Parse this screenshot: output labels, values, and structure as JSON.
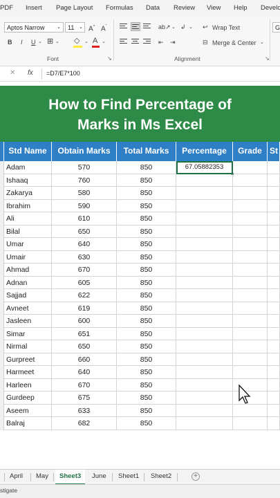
{
  "ribbon_tabs": [
    "PDF",
    "Insert",
    "Page Layout",
    "Formulas",
    "Data",
    "Review",
    "View",
    "Help",
    "Develo"
  ],
  "font": {
    "name": "Aptos Narrow",
    "size": "11",
    "group_label": "Font"
  },
  "alignment": {
    "wrap_text": "Wrap Text",
    "merge_center": "Merge & Center",
    "group_label": "Alignment"
  },
  "number_box": "Ge",
  "formula_bar": {
    "formula": "=D7/E7*100"
  },
  "banner": {
    "line1": "How to Find Percentage of",
    "line2": "Marks in Ms Excel"
  },
  "table": {
    "headers": [
      "Std Name",
      "Obtain Marks",
      "Total Marks",
      "Percentage",
      "Grade",
      "St"
    ],
    "rows": [
      [
        "Adam",
        "570",
        "850",
        "67.05882353",
        ""
      ],
      [
        "Ishaaq",
        "760",
        "850",
        "",
        ""
      ],
      [
        "Zakarya",
        "580",
        "850",
        "",
        ""
      ],
      [
        "Ibrahim",
        "590",
        "850",
        "",
        ""
      ],
      [
        "Ali",
        "610",
        "850",
        "",
        ""
      ],
      [
        "Bilal",
        "650",
        "850",
        "",
        ""
      ],
      [
        "Umar",
        "640",
        "850",
        "",
        ""
      ],
      [
        "Umair",
        "630",
        "850",
        "",
        ""
      ],
      [
        "Ahmad",
        "670",
        "850",
        "",
        ""
      ],
      [
        "Adnan",
        "605",
        "850",
        "",
        ""
      ],
      [
        "Sajjad",
        "622",
        "850",
        "",
        ""
      ],
      [
        "Avneet",
        "619",
        "850",
        "",
        ""
      ],
      [
        "Jasleen",
        "600",
        "850",
        "",
        ""
      ],
      [
        "Simar",
        "651",
        "850",
        "",
        ""
      ],
      [
        "Nirmal",
        "650",
        "850",
        "",
        ""
      ],
      [
        "Gurpreet",
        "660",
        "850",
        "",
        ""
      ],
      [
        "Harmeet",
        "640",
        "850",
        "",
        ""
      ],
      [
        "Harleen",
        "670",
        "850",
        "",
        ""
      ],
      [
        "Gurdeep",
        "675",
        "850",
        "",
        ""
      ],
      [
        "Aseem",
        "633",
        "850",
        "",
        ""
      ],
      [
        "Balraj",
        "682",
        "850",
        "",
        ""
      ]
    ]
  },
  "sheet_tabs": [
    "April",
    "May",
    "Sheet3",
    "June",
    "Sheet1",
    "Sheet2"
  ],
  "active_sheet": "Sheet3",
  "status_text": "stigate",
  "colors": {
    "banner": "#2e8b47",
    "header": "#2f7fc6",
    "accent": "#1e7145"
  }
}
